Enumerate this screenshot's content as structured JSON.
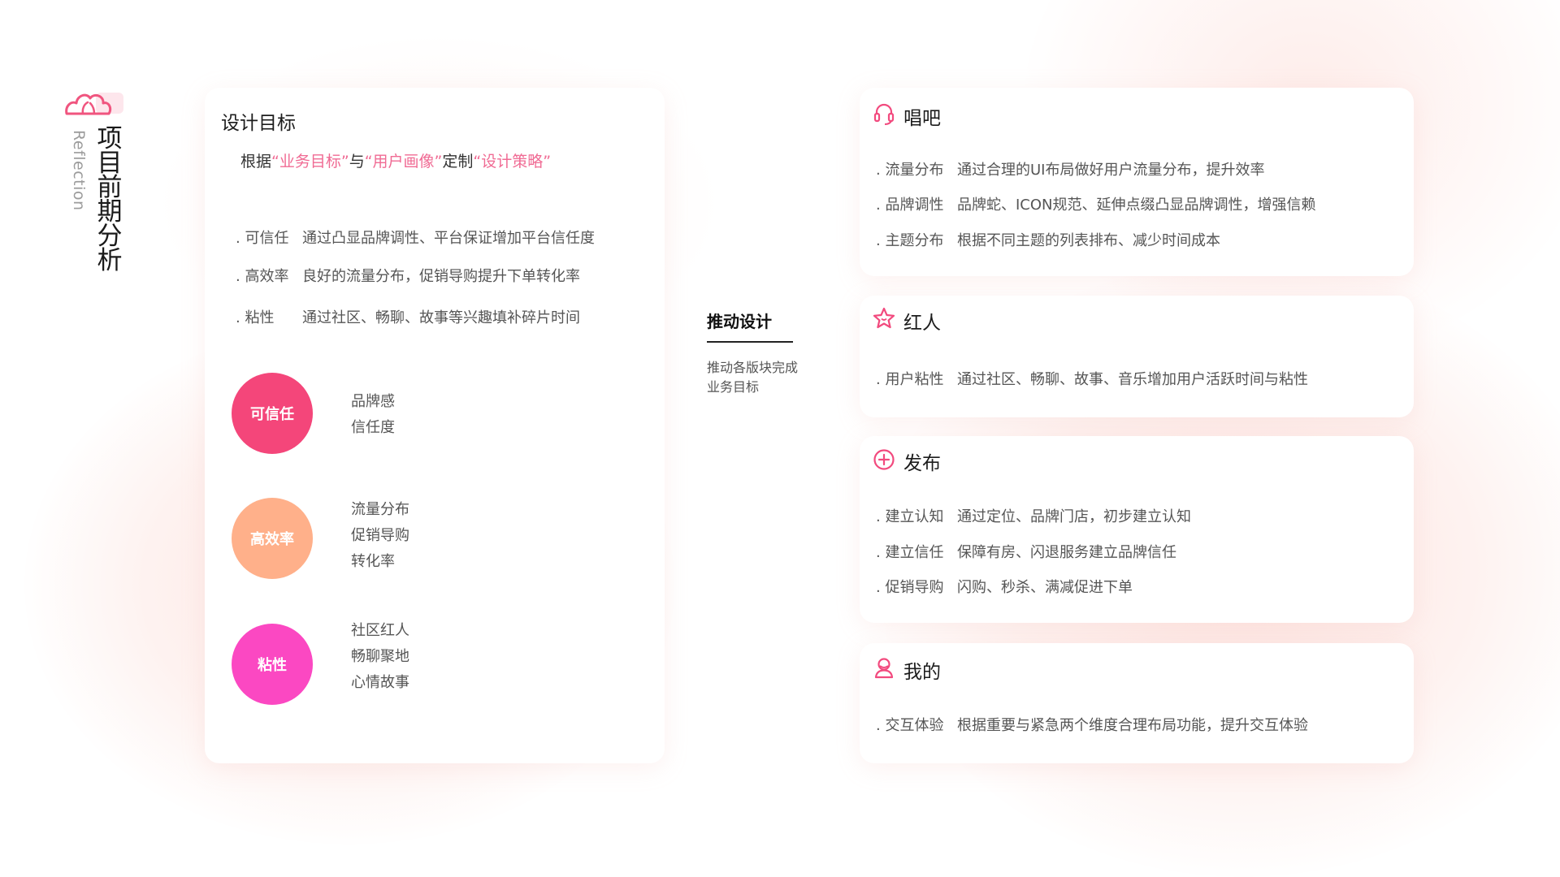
{
  "side": {
    "title_chars": [
      "项",
      "目",
      "前",
      "期",
      "分",
      "析"
    ],
    "subtitle": "Reflection"
  },
  "left": {
    "heading": "设计目标",
    "goal": {
      "prefix": "根据",
      "q1": "“业务目标”",
      "mid1": "与",
      "q2": "“用户画像”",
      "mid2": "定制",
      "q3": "“设计策略”"
    },
    "attributes": [
      {
        "key": ". 可信任",
        "text": "通过凸显品牌调性、平台保证增加平台信任度"
      },
      {
        "key": ". 高效率",
        "text": "良好的流量分布，促销导购提升下单转化率"
      },
      {
        "key": ". 粘性",
        "text": "通过社区、畅聊、故事等兴趣填补碎片时间"
      }
    ],
    "circles": [
      {
        "label": "可信任",
        "color": "#f4467a",
        "keywords": [
          "品牌感",
          "信任度"
        ]
      },
      {
        "label": "高效率",
        "color": "#ffb08a",
        "keywords": [
          "流量分布",
          "促销导购",
          "转化率"
        ]
      },
      {
        "label": "粘性",
        "color": "#fb48c2",
        "keywords": [
          "社区红人",
          "畅聊聚地",
          "心情故事"
        ]
      }
    ]
  },
  "middle": {
    "title": "推动设计",
    "desc_line1": "推动各版块完成",
    "desc_line2": "业务目标"
  },
  "right": {
    "accent": "#f24a7e",
    "cards": [
      {
        "title": "唱吧",
        "icon": "headset-icon",
        "rows": [
          {
            "key": ". 流量分布",
            "text": "通过合理的UI布局做好用户流量分布，提升效率"
          },
          {
            "key": ". 品牌调性",
            "text": "品牌蛇、ICON规范、延伸点缀凸显品牌调性，增强信赖"
          },
          {
            "key": ". 主题分布",
            "text": "根据不同主题的列表排布、减少时间成本"
          }
        ]
      },
      {
        "title": "红人",
        "icon": "star-icon",
        "rows": [
          {
            "key": ". 用户粘性",
            "text": "通过社区、畅聊、故事、音乐增加用户活跃时间与粘性"
          }
        ]
      },
      {
        "title": "发布",
        "icon": "plus-circle-icon",
        "rows": [
          {
            "key": ". 建立认知",
            "text": "通过定位、品牌门店，初步建立认知"
          },
          {
            "key": ". 建立信任",
            "text": "保障有房、闪退服务建立品牌信任"
          },
          {
            "key": ". 促销导购",
            "text": "闪购、秒杀、满减促进下单"
          }
        ]
      },
      {
        "title": "我的",
        "icon": "user-icon",
        "rows": [
          {
            "key": ". 交互体验",
            "text": "根据重要与紧急两个维度合理布局功能，提升交互体验"
          }
        ]
      }
    ]
  }
}
